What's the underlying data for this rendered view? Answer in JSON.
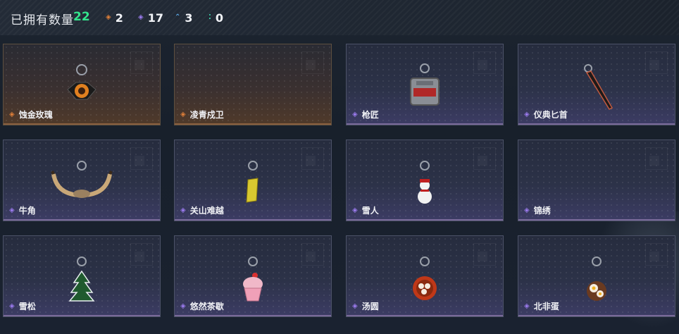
{
  "header": {
    "title": "已拥有数量",
    "total": "22",
    "stats": [
      {
        "icon": "orange-diamond-icon",
        "color": "#e0803a",
        "value": "2"
      },
      {
        "icon": "purple-diamond-icon",
        "color": "#9d7cf0",
        "value": "17"
      },
      {
        "icon": "blue-chevron-icon",
        "color": "#5aa8e8",
        "value": "3"
      },
      {
        "icon": "green-dots-icon",
        "color": "#3ad0a8",
        "value": "0"
      }
    ]
  },
  "items": [
    {
      "name": "蚀金玫瑰",
      "rarity": "orange",
      "icon": "rose-pendant-icon"
    },
    {
      "name": "凌青戍卫",
      "rarity": "orange",
      "icon": ""
    },
    {
      "name": "枪匠",
      "rarity": "purple",
      "icon": "gunsmith-case-icon"
    },
    {
      "name": "仪典匕首",
      "rarity": "purple",
      "icon": "dagger-icon"
    },
    {
      "name": "牛角",
      "rarity": "purple",
      "icon": "horns-icon"
    },
    {
      "name": "关山难越",
      "rarity": "purple",
      "icon": "gold-bar-icon"
    },
    {
      "name": "雪人",
      "rarity": "purple",
      "icon": "snowman-icon"
    },
    {
      "name": "锦绣",
      "rarity": "purple",
      "icon": ""
    },
    {
      "name": "雪松",
      "rarity": "purple",
      "icon": "pine-tree-icon"
    },
    {
      "name": "悠然茶歇",
      "rarity": "purple",
      "icon": "cupcake-icon"
    },
    {
      "name": "汤圆",
      "rarity": "purple",
      "icon": "soup-bowl-icon"
    },
    {
      "name": "北非蛋",
      "rarity": "purple",
      "icon": "egg-dish-icon"
    }
  ]
}
